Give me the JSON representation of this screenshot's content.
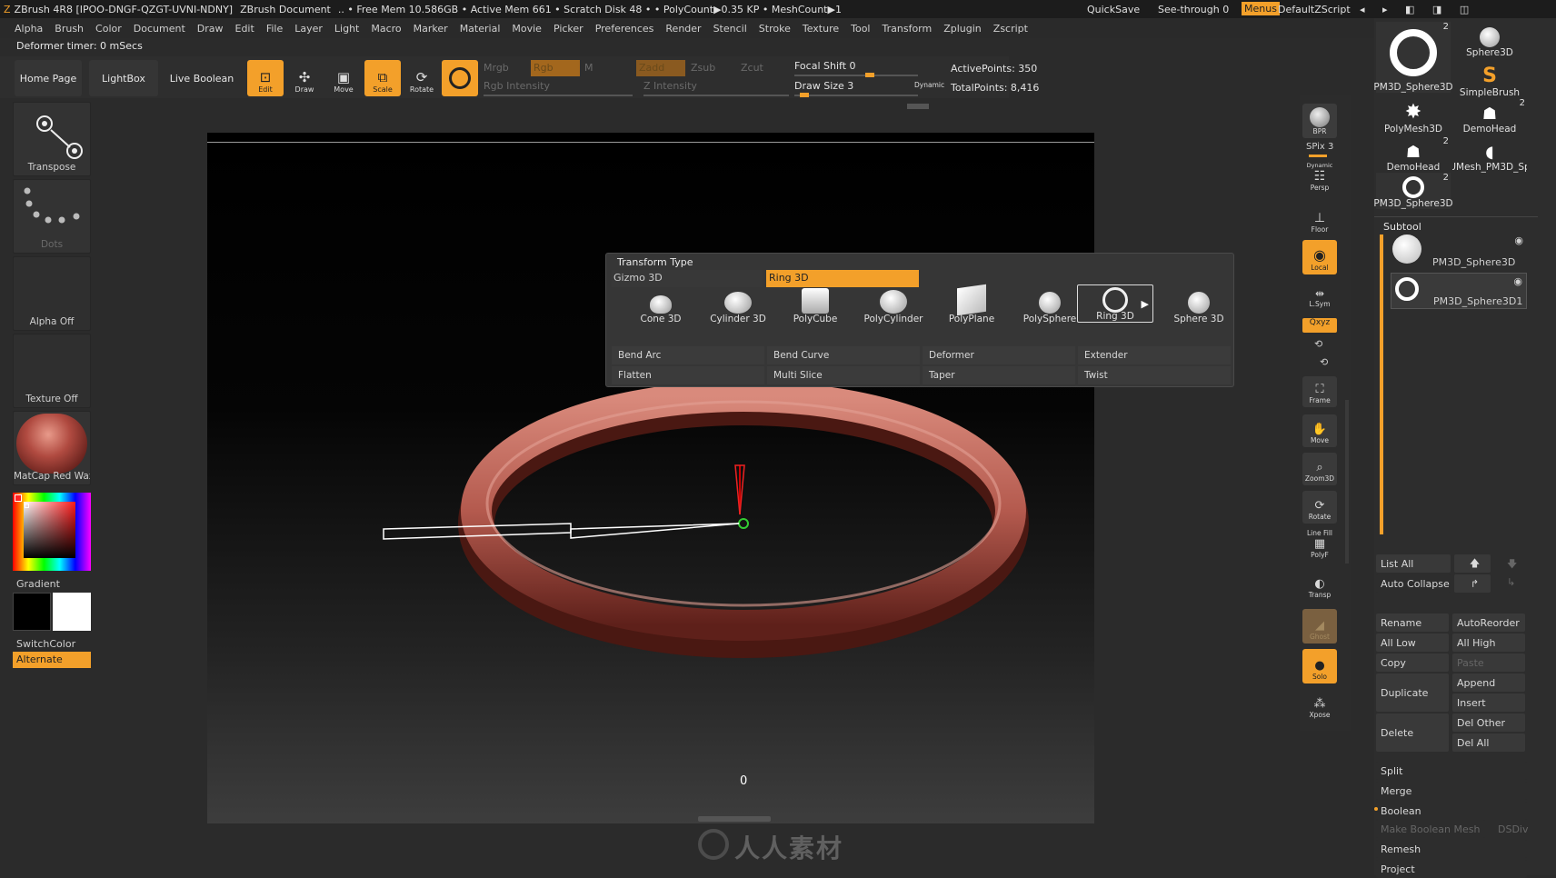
{
  "titlebar": {
    "app": "ZBrush 4R8 [IPOO-DNGF-QZGT-UVNI-NDNY]",
    "document": "ZBrush Document",
    "mem": ".. • Free Mem 10.586GB • Active Mem 661 • Scratch Disk 48 • • PolyCount▶0.35 KP • MeshCount▶1",
    "quicksave": "QuickSave",
    "seethrough": "See-through  0",
    "menus": "Menus",
    "defaultzscript": "DefaultZScript"
  },
  "menubar": [
    "Alpha",
    "Brush",
    "Color",
    "Document",
    "Draw",
    "Edit",
    "File",
    "Layer",
    "Light",
    "Macro",
    "Marker",
    "Material",
    "Movie",
    "Picker",
    "Preferences",
    "Render",
    "Stencil",
    "Stroke",
    "Texture",
    "Tool",
    "Transform",
    "Zplugin",
    "Zscript"
  ],
  "timer": "Deformer timer: 0 mSecs",
  "nav": {
    "home": "Home Page",
    "lightbox": "LightBox",
    "liveboolean": "Live Boolean"
  },
  "tools": {
    "edit": "Edit",
    "draw": "Draw",
    "move": "Move",
    "scale": "Scale",
    "rotate": "Rotate"
  },
  "topcontrols": {
    "mrgb": "Mrgb",
    "rgb": "Rgb",
    "m": "M",
    "rgb_intensity": "Rgb Intensity",
    "zadd": "Zadd",
    "zsub": "Zsub",
    "zcut": "Zcut",
    "z_intensity": "Z Intensity",
    "focal_shift": "Focal Shift 0",
    "draw_size": "Draw Size 3",
    "dynamic": "Dynamic",
    "active_points": "ActivePoints: 350",
    "total_points": "TotalPoints: 8,416"
  },
  "left": {
    "transpose": "Transpose",
    "dots": "Dots",
    "alpha": "Alpha Off",
    "texture": "Texture Off",
    "material": "MatCap Red Wax",
    "gradient": "Gradient",
    "switchcolor": "SwitchColor",
    "alternate": "Alternate"
  },
  "popup": {
    "title": "Transform Type",
    "gizmo": "Gizmo 3D",
    "selected": "Ring 3D",
    "items": [
      "Cone 3D",
      "Cylinder 3D",
      "PolyCube",
      "PolyCylinder",
      "PolyPlane",
      "PolySphere",
      "Ring 3D",
      "Sphere 3D"
    ],
    "rows": [
      [
        "Bend Arc",
        "Bend Curve",
        "Deformer",
        "Extender"
      ],
      [
        "Flatten",
        "Multi Slice",
        "Taper",
        "Twist"
      ]
    ]
  },
  "viewport": {
    "counter": "0",
    "watermark": "人人素材"
  },
  "shelf": {
    "bpr": "BPR",
    "spix": "SPix 3",
    "persp": "Persp",
    "floor": "Floor",
    "local": "Local",
    "lsym": "L.Sym",
    "xyz": "Qxyz",
    "frame": "Frame",
    "move": "Move",
    "zoom": "Zoom3D",
    "rotate": "Rotate",
    "linefill": "Line Fill",
    "polyf": "PolyF",
    "transp": "Transp",
    "ghost": "Ghost",
    "solo": "Solo",
    "xpose": "Xpose",
    "dynamic": "Dynamic"
  },
  "toolpanel": {
    "thumbs": [
      "PM3D_Sphere3D",
      "Sphere3D",
      "SimpleBrush",
      "PolyMesh3D",
      "DemoHead",
      "DemoHead",
      "UMesh_PM3D_Sp",
      "PM3D_Sphere3D"
    ],
    "badges": [
      "2",
      "2",
      "2",
      "2"
    ],
    "subtool": "Subtool",
    "subtools": [
      "PM3D_Sphere3D",
      "PM3D_Sphere3D1"
    ],
    "list_all": "List All",
    "auto_collapse": "Auto Collapse",
    "rename": "Rename",
    "autoreorder": "AutoReorder",
    "all_low": "All Low",
    "all_high": "All High",
    "copy": "Copy",
    "paste": "Paste",
    "duplicate": "Duplicate",
    "append": "Append",
    "insert": "Insert",
    "delete": "Delete",
    "del_other": "Del Other",
    "del_all": "Del All",
    "split": "Split",
    "merge": "Merge",
    "boolean": "Boolean",
    "make_boolean": "Make Boolean Mesh",
    "dsdiv": "DSDiv",
    "remesh": "Remesh",
    "project": "Project"
  }
}
